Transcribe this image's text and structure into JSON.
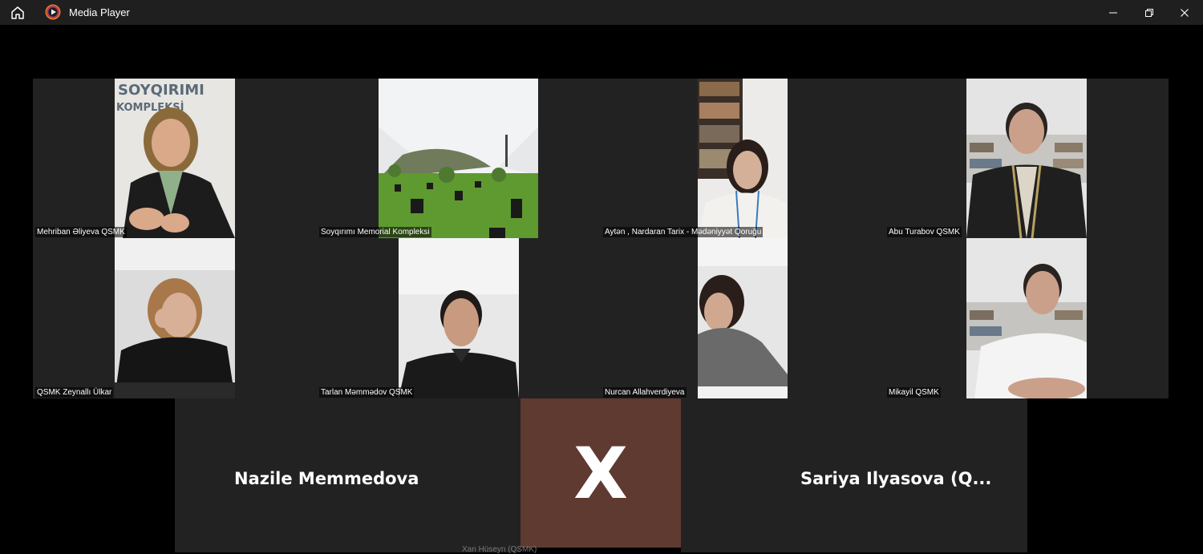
{
  "window": {
    "title": "Media Player",
    "icons": {
      "home": "home-icon",
      "app": "media-player-icon",
      "minimize": "minimize-icon",
      "maximize": "maximize-icon",
      "close": "close-icon"
    }
  },
  "participants": [
    {
      "name": "Mehriban Əliyeva QSMK",
      "banner_text": "SOYQIRIMI",
      "banner_text2": "KOMPLEKSİ"
    },
    {
      "name": "Soyqırımı Memorial Kompleksi"
    },
    {
      "name": "Aytən , Nardaran Tarix - Mədəniyyət Qoruğu"
    },
    {
      "name": "Abu Turabov QSMK"
    },
    {
      "name": "QSMK Zeynallı Ülkar"
    },
    {
      "name": "Tarlan Məmmədov QSMK"
    },
    {
      "name": "Nurcan Allahverdiyeva"
    },
    {
      "name": "Mikayil QSMK"
    }
  ],
  "bottom_row": {
    "left_name": "Nazile Memmedova",
    "center_initial": "X",
    "center_name": "Xan Hüseyn (QSMK)",
    "right_name": "Sariya Ilyasova (Q..."
  },
  "colors": {
    "tile_bg": "#222222",
    "avatar_bg": "#5e3a31",
    "titlebar_bg": "#1f1f1f"
  }
}
